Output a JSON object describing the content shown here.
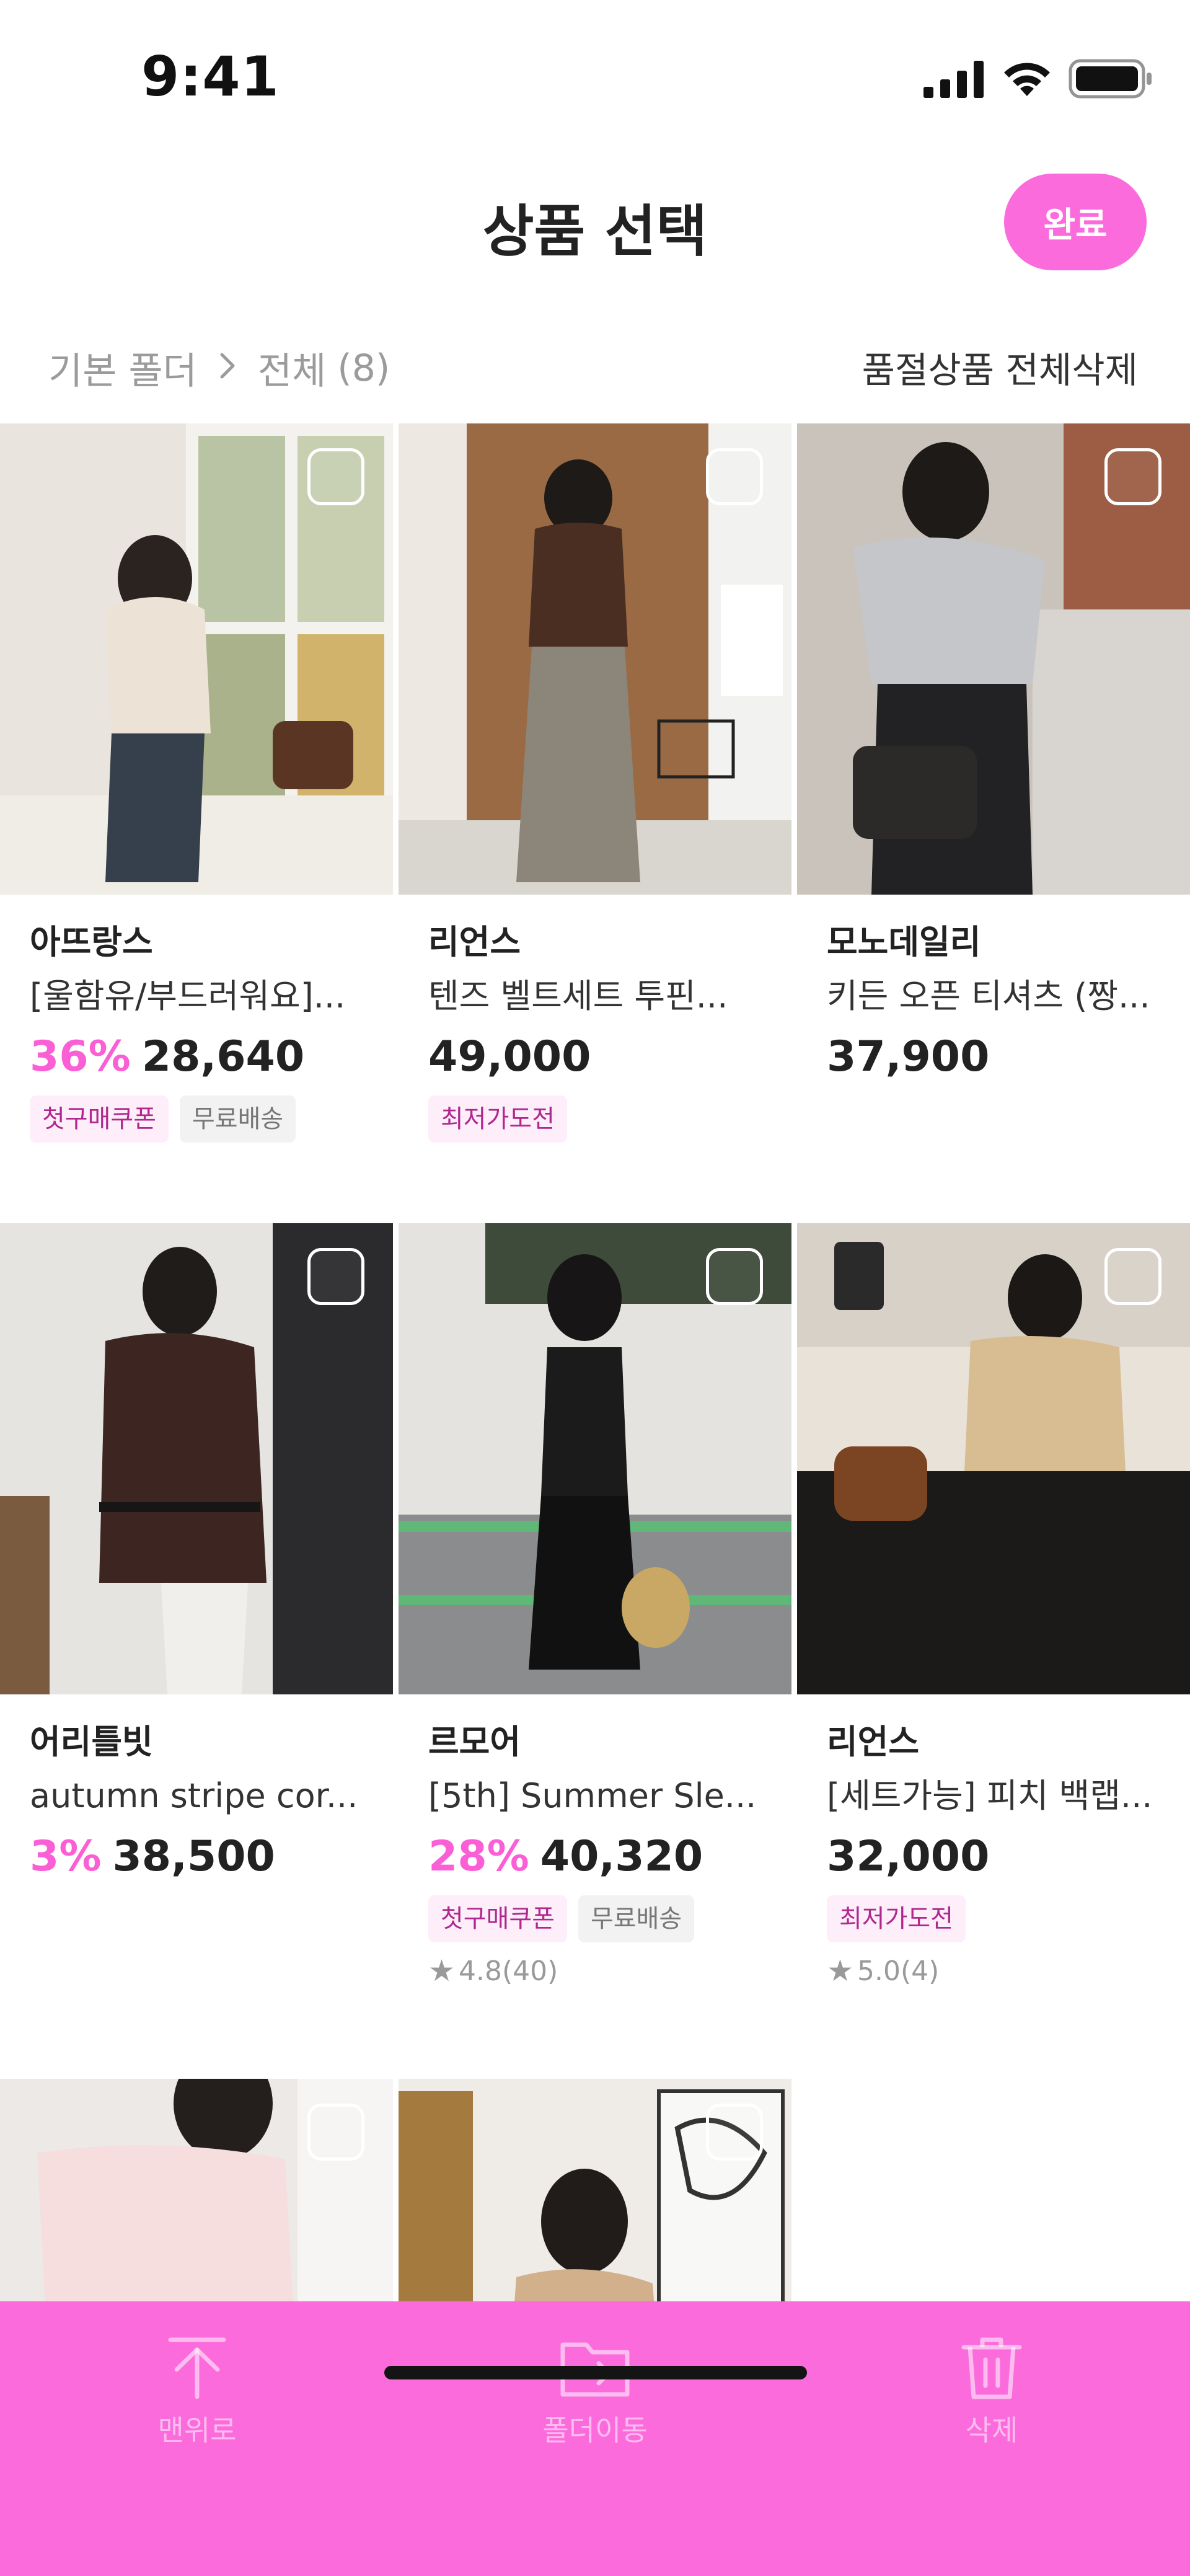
{
  "status": {
    "time": "9:41"
  },
  "header": {
    "title": "상품 선택",
    "done_label": "완료"
  },
  "breadcrumb": {
    "folder": "기본 폴더",
    "current": "전체",
    "count": "(8)",
    "delete_soldout_label": "품절상품 전체삭제"
  },
  "products": [
    {
      "brand": "아뜨랑스",
      "name": "[울함유/부드러워요]...",
      "discount": "36%",
      "price": "28,640",
      "tags": [
        "첫구매쿠폰",
        "무료배송"
      ],
      "rating": ""
    },
    {
      "brand": "리언스",
      "name": "텐즈 벨트세트 투핀...",
      "discount": "",
      "price": "49,000",
      "tags": [
        "최저가도전"
      ],
      "rating": ""
    },
    {
      "brand": "모노데일리",
      "name": "키든 오픈 티셔츠 (짱...",
      "discount": "",
      "price": "37,900",
      "tags": [],
      "rating": ""
    },
    {
      "brand": "어리틀빗",
      "name": "autumn stripe cor...",
      "discount": "3%",
      "price": "38,500",
      "tags": [],
      "rating": ""
    },
    {
      "brand": "르모어",
      "name": "[5th] Summer Sle...",
      "discount": "28%",
      "price": "40,320",
      "tags": [
        "첫구매쿠폰",
        "무료배송"
      ],
      "rating": "4.8(40)"
    },
    {
      "brand": "리언스",
      "name": "[세트가능] 피치 백랩...",
      "discount": "",
      "price": "32,000",
      "tags": [
        "최저가도전"
      ],
      "rating": "5.0(4)"
    },
    {
      "brand": "",
      "name": "",
      "discount": "",
      "price": "",
      "tags": [],
      "rating": ""
    },
    {
      "brand": "",
      "name": "",
      "discount": "",
      "price": "",
      "tags": [],
      "rating": ""
    }
  ],
  "bottom_bar": {
    "items": [
      {
        "label": "맨위로",
        "icon": "arrow-up-to-top-icon"
      },
      {
        "label": "폴더이동",
        "icon": "folder-move-icon"
      },
      {
        "label": "삭제",
        "icon": "trash-icon"
      }
    ]
  },
  "colors": {
    "accent": "#fb6bdc",
    "discount": "#fb5fd6",
    "tag_pink_bg": "#fdeefa",
    "tag_pink_text": "#b0288f"
  }
}
